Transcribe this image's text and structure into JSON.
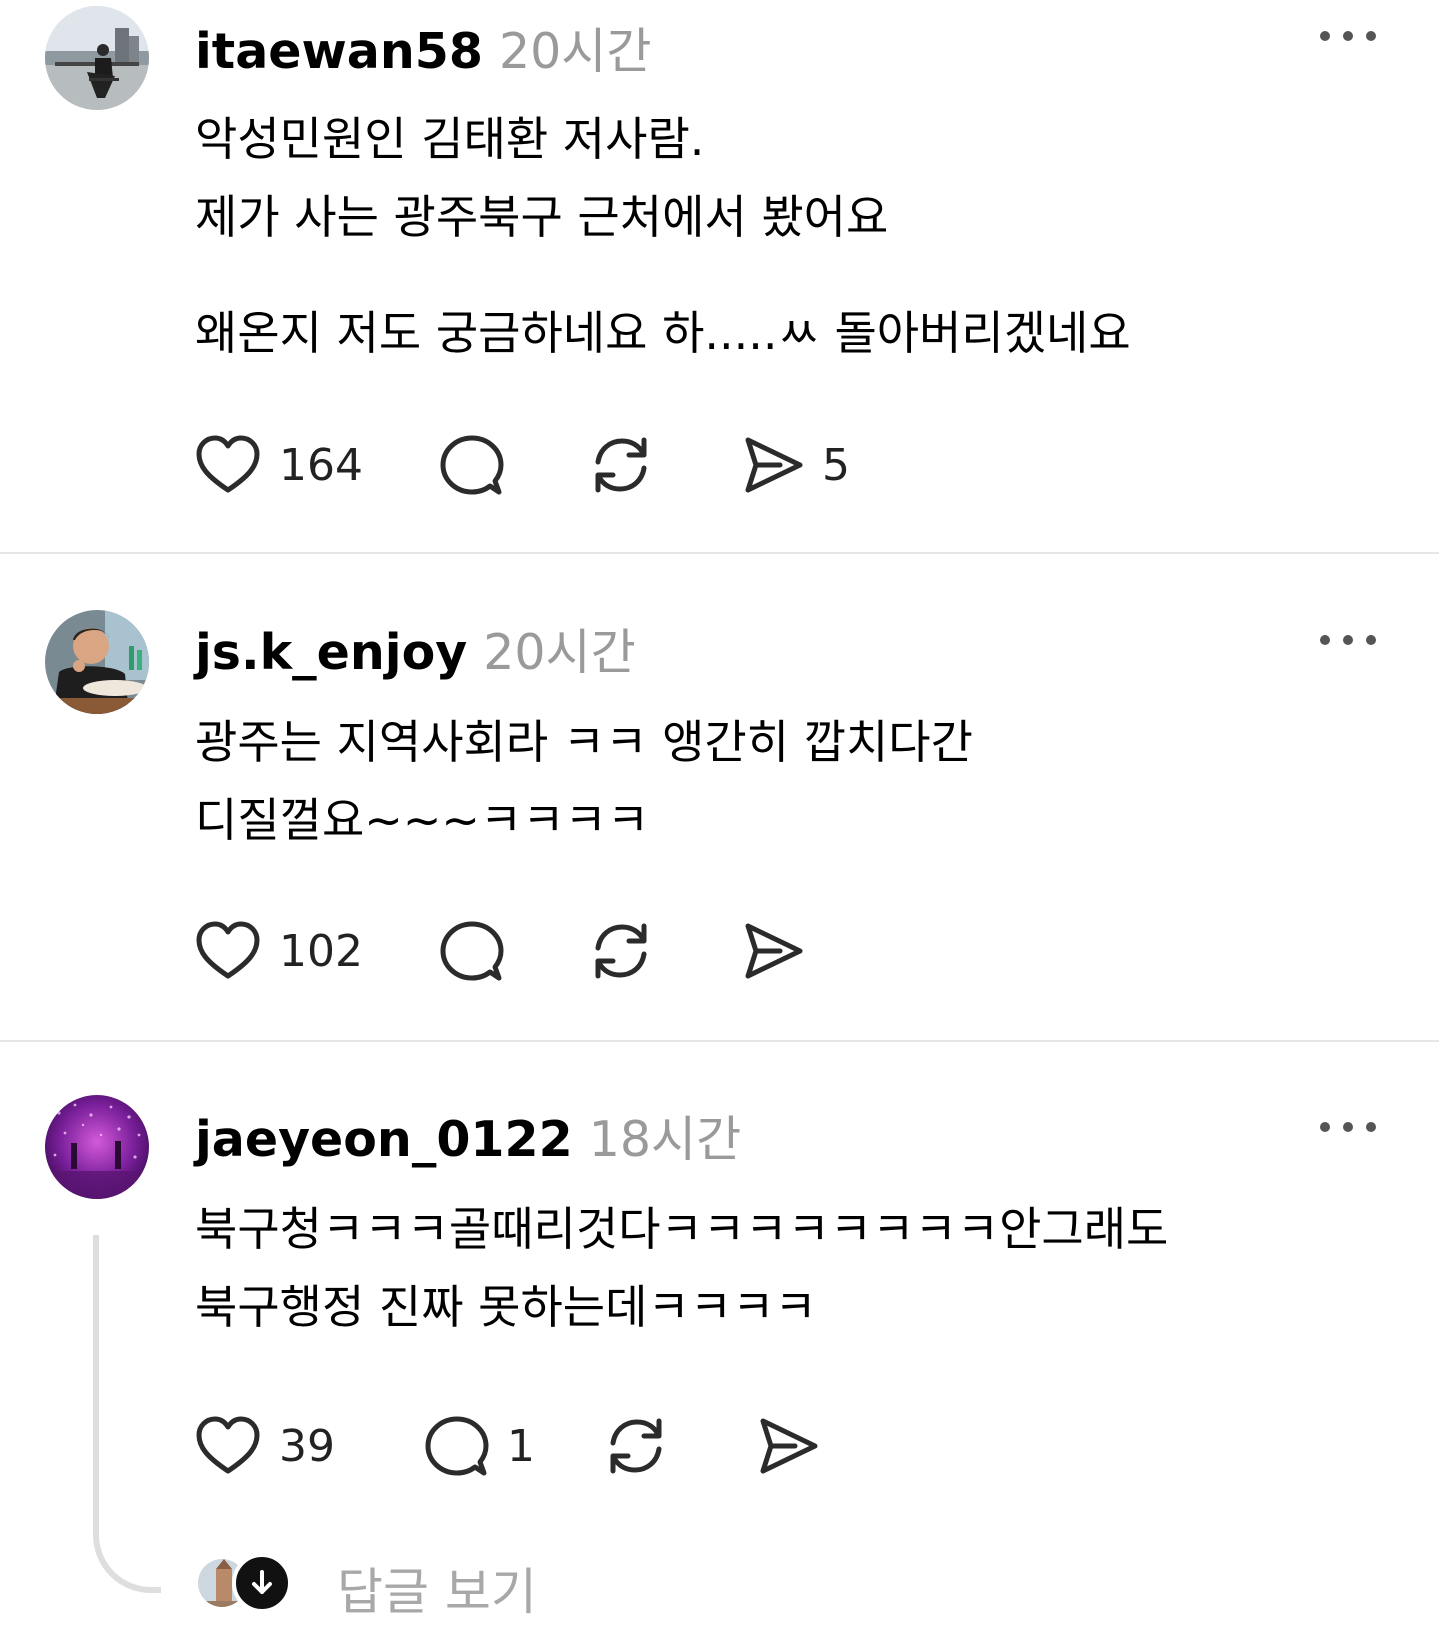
{
  "posts": [
    {
      "username": "itaewan58",
      "time": "20시간",
      "lines": [
        "악성민원인 김태환 저사람.",
        "제가 사는 광주북구 근처에서 봤어요",
        "왜온지 저도 궁금하네요 하.....ㅆ 돌아버리겠네요"
      ],
      "likes": "164",
      "comments": "",
      "shares": "5"
    },
    {
      "username": "js.k_enjoy",
      "time": "20시간",
      "lines": [
        "광주는 지역사회라 ㅋㅋ 앵간히 깝치다간",
        "디질껄요~~~ㅋㅋㅋㅋ"
      ],
      "likes": "102",
      "comments": "",
      "shares": ""
    },
    {
      "username": "jaeyeon_0122",
      "time": "18시간",
      "lines": [
        "북구청ㅋㅋㅋ골때리것다ㅋㅋㅋㅋㅋㅋㅋㅋ안그래도",
        "북구행정 진짜 못하는데ㅋㅋㅋㅋ"
      ],
      "likes": "39",
      "comments": "1",
      "shares": ""
    }
  ],
  "replies_link": "답글 보기",
  "icons": {
    "like": "heart-icon",
    "comment": "speech-bubble-icon",
    "repost": "repost-icon",
    "share": "send-icon",
    "more": "more-dots-icon",
    "expand": "arrow-down-icon"
  },
  "colors": {
    "text": "#000000",
    "muted": "#9a9a9a",
    "icon": "#2b2b2b",
    "divider": "#e6e6e6"
  }
}
